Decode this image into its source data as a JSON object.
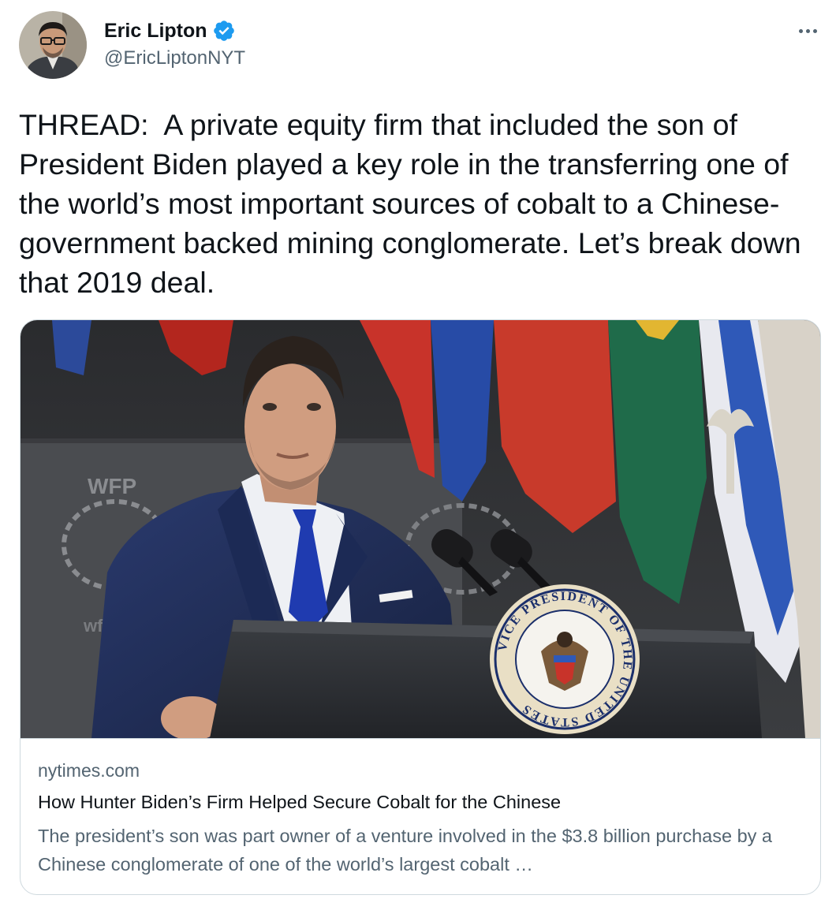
{
  "author": {
    "display_name": "Eric Lipton",
    "handle": "@EricLiptonNYT",
    "verified": true,
    "avatar_icon": "profile-photo-man-glasses"
  },
  "menu_icon": "more-options-icon",
  "tweet": {
    "text": "THREAD:  A private equity firm that included the son of President Biden played a key role in the transferring one of the world’s most important sources of cobalt to a Chinese-government backed mining conglomerate. Let’s break down that 2019 deal."
  },
  "link_card": {
    "domain": "nytimes.com",
    "title": "How Hunter Biden’s Firm Helped Secure Cobalt for the Chinese",
    "description": "The president’s son was part owner of a venture involved in the $3.8 billion purchase by a Chinese conglomerate of one of the world’s largest cobalt …",
    "image": {
      "podium_seal_text": "VICE PRESIDENT OF THE UNITED STATES",
      "banner_text_1": "WFP",
      "banner_text_2": "wfp"
    }
  },
  "colors": {
    "text_primary": "#0f1419",
    "text_secondary": "#536471",
    "verified_blue": "#1d9bf0",
    "border": "#cfd9de"
  }
}
